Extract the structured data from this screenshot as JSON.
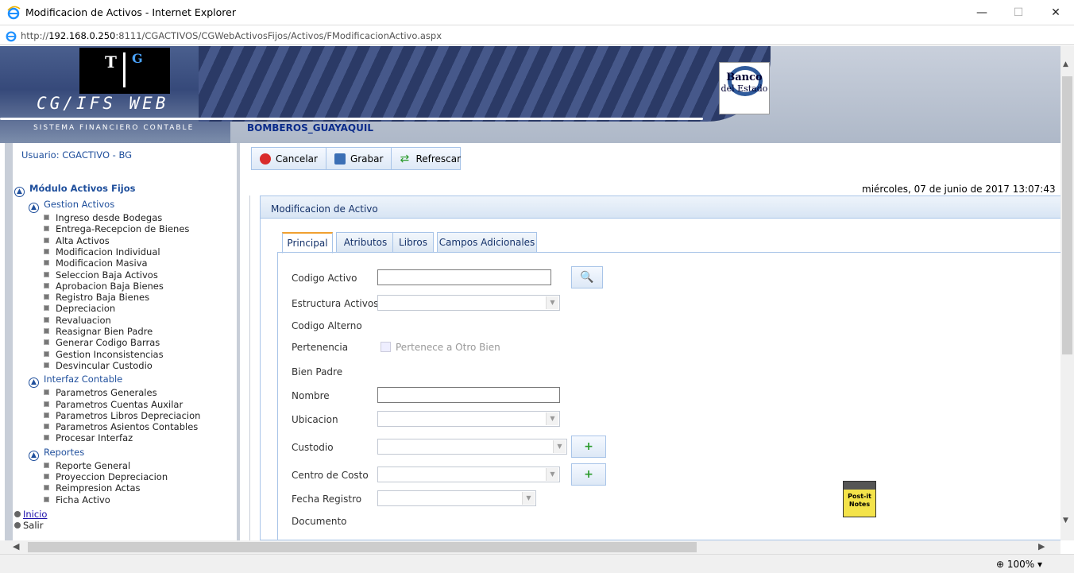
{
  "window": {
    "title": "Modificacion de Activos - Internet Explorer",
    "minimize": "—",
    "maximize": "☐",
    "close": "✕"
  },
  "address": {
    "prefix": "http://",
    "host": "192.168.0.250",
    "rest": ":8111/CGACTIVOS/CGWebActivosFijos/Activos/FModificacionActivo.aspx"
  },
  "banner": {
    "logo_t": "T",
    "logo_g": "G",
    "product": "CG/IFS  WEB",
    "subtitle": "SISTEMA FINANCIERO CONTABLE",
    "organization": "BOMBEROS_GUAYAQUIL",
    "bank_logo_line1": "Banco",
    "bank_logo_line2": "del Estado"
  },
  "sidebar": {
    "user": "Usuario: CGACTIVO - BG",
    "module": "Módulo Activos Fijos",
    "groups": [
      {
        "label": "Gestion Activos",
        "items": [
          "Ingreso desde Bodegas",
          "Entrega-Recepcion de Bienes",
          "Alta Activos",
          "Modificacion Individual",
          "Modificacion Masiva",
          "Seleccion Baja Activos",
          "Aprobacion Baja Bienes",
          "Registro Baja Bienes",
          "Depreciacion",
          "Revaluacion",
          "Reasignar Bien Padre",
          "Generar Codigo Barras",
          "Gestion Inconsistencias",
          "Desvincular Custodio"
        ]
      },
      {
        "label": "Interfaz Contable",
        "items": [
          "Parametros Generales",
          "Parametros Cuentas Auxilar",
          "Parametros Libros Depreciacion",
          "Parametros Asientos Contables",
          "Procesar Interfaz"
        ]
      },
      {
        "label": "Reportes",
        "items": [
          "Reporte General",
          "Proyeccion Depreciacion",
          "Reimpresion Actas",
          "Ficha Activo"
        ]
      }
    ],
    "inicio": "Inicio",
    "salir": "Salir"
  },
  "toolbar": {
    "cancel": "Cancelar",
    "save": "Grabar",
    "refresh": "Refrescar"
  },
  "datetime": "miércoles, 07 de junio de 2017 13:07:43",
  "panel": {
    "title": "Modificacion de Activo"
  },
  "tabs": [
    "Principal",
    "Atributos",
    "Libros",
    "Campos Adicionales"
  ],
  "form": {
    "codigo_activo": "Codigo Activo",
    "estructura_activos": "Estructura Activos",
    "codigo_alterno": "Codigo Alterno",
    "pertenencia": "Pertenencia",
    "pertenece_checkbox": "Pertenece a Otro Bien",
    "bien_padre": "Bien Padre",
    "nombre": "Nombre",
    "ubicacion": "Ubicacion",
    "custodio": "Custodio",
    "centro_costo": "Centro de Costo",
    "fecha_registro": "Fecha Registro",
    "documento": "Documento"
  },
  "postit": {
    "line1": "Post-it",
    "line2": "Notes"
  },
  "status": {
    "zoom": "100%"
  }
}
